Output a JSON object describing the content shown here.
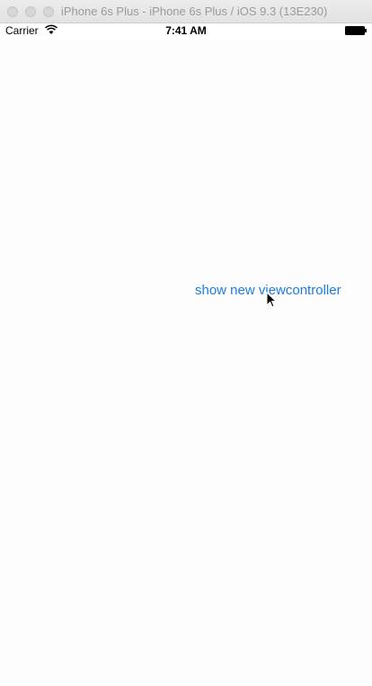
{
  "window": {
    "title": "iPhone 6s Plus - iPhone 6s Plus / iOS 9.3 (13E230)"
  },
  "statusbar": {
    "carrier": "Carrier",
    "time": "7:41 AM",
    "wifi_icon": "wifi-icon",
    "battery_icon": "battery-icon"
  },
  "main": {
    "button_label": "show new viewcontroller",
    "button_color": "#1a7ee0"
  },
  "pointer": {
    "icon": "mouse-cursor-icon"
  }
}
